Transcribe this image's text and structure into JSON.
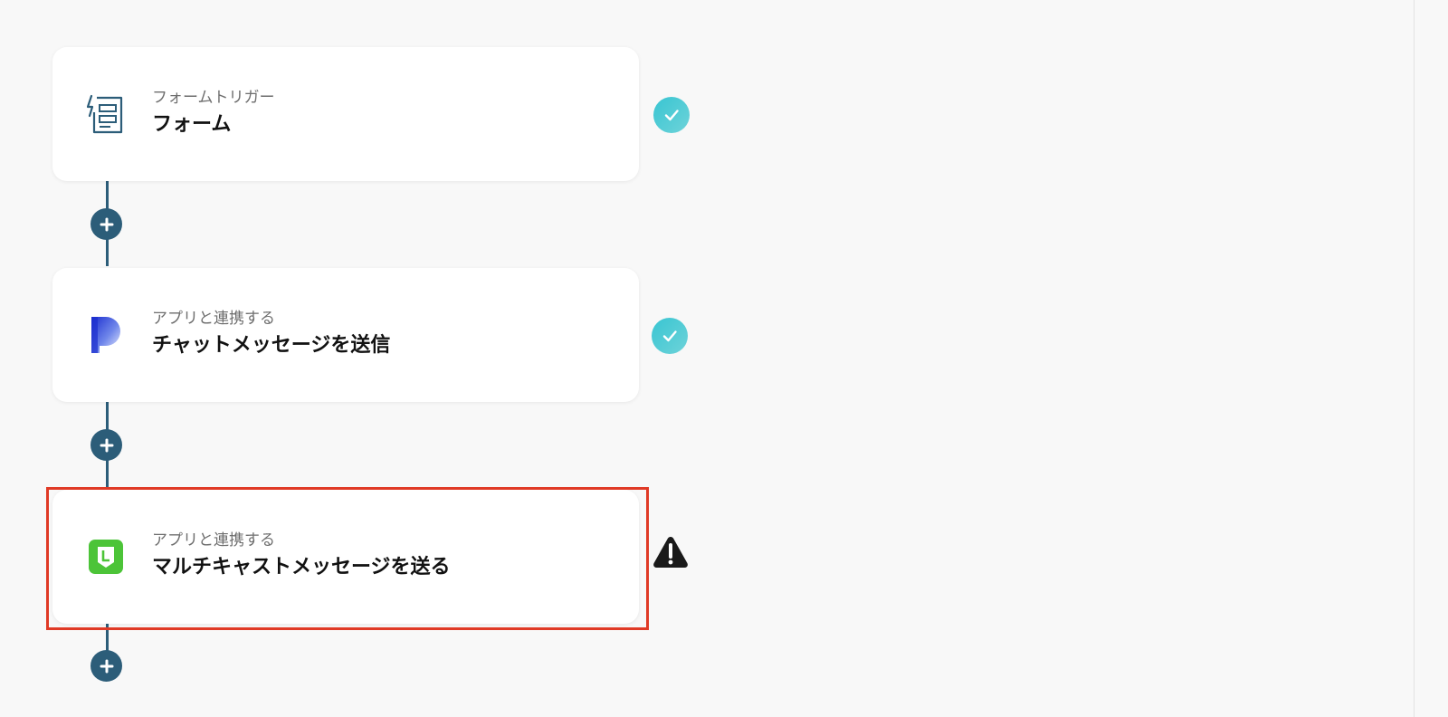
{
  "flow": {
    "steps": [
      {
        "subtitle": "フォームトリガー",
        "title": "フォーム",
        "icon": "form-trigger-icon",
        "status": "complete"
      },
      {
        "subtitle": "アプリと連携する",
        "title": "チャットメッセージを送信",
        "icon": "chat-app-logo-icon",
        "status": "complete"
      },
      {
        "subtitle": "アプリと連携する",
        "title": "マルチキャストメッセージを送る",
        "icon": "line-app-logo-icon",
        "status": "warning",
        "highlighted": true
      }
    ]
  },
  "colors": {
    "background": "#f8f8f8",
    "connector": "#2c5d79",
    "check_badge": "#4ccbd6",
    "highlight": "#e03a26",
    "warning": "#1a1a1a",
    "line_green": "#4cc438",
    "form_icon": "#2c5d79"
  }
}
